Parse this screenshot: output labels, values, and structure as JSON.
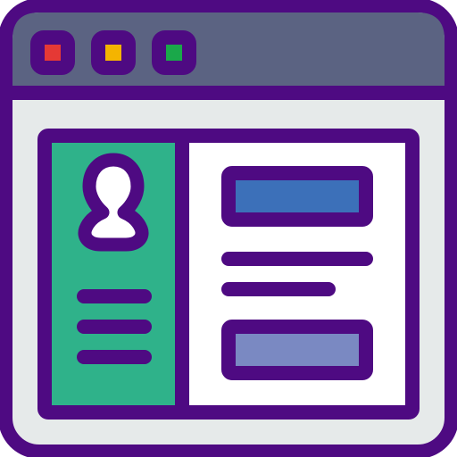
{
  "icon": {
    "semantic": "browser-window-profile-page-icon",
    "window_controls": [
      "close-icon",
      "minimize-icon",
      "maximize-icon"
    ],
    "sidebar": {
      "avatar_icon": "user-avatar-icon",
      "text_lines": 3
    },
    "content": {
      "blocks": [
        "header-block",
        "text-line",
        "text-line",
        "info-block"
      ]
    }
  },
  "colors": {
    "outline": "#4e0a82",
    "titlebar": "#5b6382",
    "window_body": "#e6eaea",
    "page": "#ffffff",
    "sidebar": "#2fb28a",
    "control_red": "#e53935",
    "control_yellow": "#f4b400",
    "control_green": "#1aa84a",
    "block_primary": "#3c70b9",
    "block_secondary": "#7a89c2"
  }
}
